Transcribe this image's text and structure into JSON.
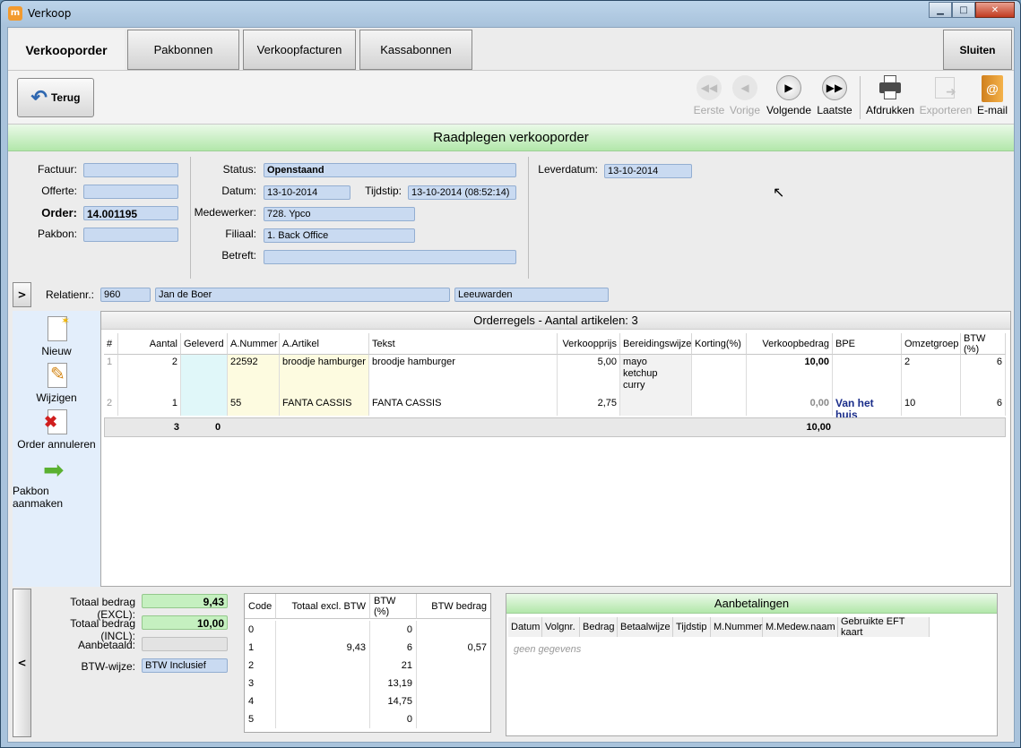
{
  "window": {
    "title": "Verkoop",
    "app_icon": "m"
  },
  "tabs": [
    {
      "label": "Verkooporder"
    },
    {
      "label": "Pakbonnen"
    },
    {
      "label": "Verkoopfacturen"
    },
    {
      "label": "Kassabonnen"
    }
  ],
  "close_label": "Sluiten",
  "toolbar": {
    "back": "Terug",
    "first": "Eerste",
    "prev": "Vorige",
    "next": "Volgende",
    "last": "Laatste",
    "print": "Afdrukken",
    "export": "Exporteren",
    "email": "E-mail"
  },
  "header": "Raadplegen verkooporder",
  "docs": {
    "factuur_label": "Factuur:",
    "factuur": "",
    "offerte_label": "Offerte:",
    "offerte": "",
    "order_label": "Order:",
    "order": "14.001195",
    "pakbon_label": "Pakbon:",
    "pakbon": ""
  },
  "details": {
    "status_label": "Status:",
    "status": "Openstaand",
    "datum_label": "Datum:",
    "datum": "13-10-2014",
    "tijdstip_label": "Tijdstip:",
    "tijdstip": "13-10-2014 (08:52:14)",
    "medewerker_label": "Medewerker:",
    "medewerker": "728. Ypco",
    "filiaal_label": "Filiaal:",
    "filiaal": "1. Back Office",
    "betreft_label": "Betreft:",
    "betreft": ""
  },
  "leverdatum_label": "Leverdatum:",
  "leverdatum": "13-10-2014",
  "relatie": {
    "label": "Relatienr.:",
    "nr": "960",
    "naam": "Jan de Boer",
    "plaats": "Leeuwarden"
  },
  "expand_label": ">",
  "collapse_label": "<",
  "actions": {
    "new": "Nieuw",
    "edit": "Wijzigen",
    "cancel": "Order annuleren",
    "packslip": "Pakbon aanmaken"
  },
  "orderregels": {
    "title": "Orderregels - Aantal artikelen: 3",
    "columns": [
      "#",
      "Aantal",
      "Geleverd",
      "A.Nummer",
      "A.Artikel",
      "Tekst",
      "Verkoopprijs",
      "Bereidingswijze",
      "Korting(%)",
      "Verkoopbedrag",
      "BPE",
      "Omzetgroep",
      "BTW (%)"
    ],
    "rows": [
      {
        "nr": "1",
        "aantal": "2",
        "geleverd": "",
        "anummer": "22592",
        "artikel": "broodje hamburger",
        "tekst": "broodje hamburger",
        "prijs": "5,00",
        "bereiding": "mayo\nketchup\ncurry",
        "korting": "",
        "bedrag": "10,00",
        "bpe": "",
        "omzetgroep": "2",
        "btw": "6"
      },
      {
        "nr": "2",
        "aantal": "1",
        "geleverd": "",
        "anummer": "55",
        "artikel": "FANTA CASSIS",
        "tekst": "FANTA CASSIS",
        "prijs": "2,75",
        "bereiding": "",
        "korting": "",
        "bedrag": "0,00",
        "bpe": "Van het huis",
        "omzetgroep": "10",
        "btw": "6"
      }
    ],
    "totals": {
      "aantal": "3",
      "geleverd": "0",
      "bedrag": "10,00"
    }
  },
  "totalen": {
    "excl_label": "Totaal bedrag (EXCL):",
    "excl": "9,43",
    "incl_label": "Totaal bedrag (INCL):",
    "incl": "10,00",
    "aanbetaald_label": "Aanbetaald:",
    "aanbetaald": "",
    "btwwijze_label": "BTW-wijze:",
    "btwwijze": "BTW Inclusief"
  },
  "btw_table": {
    "columns": [
      "Code",
      "Totaal excl. BTW",
      "BTW (%)",
      "BTW bedrag"
    ],
    "rows": [
      {
        "code": "0",
        "excl": "",
        "pct": "0",
        "bedrag": ""
      },
      {
        "code": "1",
        "excl": "9,43",
        "pct": "6",
        "bedrag": "0,57"
      },
      {
        "code": "2",
        "excl": "",
        "pct": "21",
        "bedrag": ""
      },
      {
        "code": "3",
        "excl": "",
        "pct": "13,19",
        "bedrag": ""
      },
      {
        "code": "4",
        "excl": "",
        "pct": "14,75",
        "bedrag": ""
      },
      {
        "code": "5",
        "excl": "",
        "pct": "0",
        "bedrag": ""
      }
    ]
  },
  "aanbetalingen": {
    "title": "Aanbetalingen",
    "columns": [
      "Datum",
      "Volgnr.",
      "Bedrag",
      "Betaalwijze",
      "Tijdstip",
      "M.Nummer",
      "M.Medew.naam",
      "Gebruikte EFT kaart"
    ],
    "empty": "geen gegevens"
  }
}
